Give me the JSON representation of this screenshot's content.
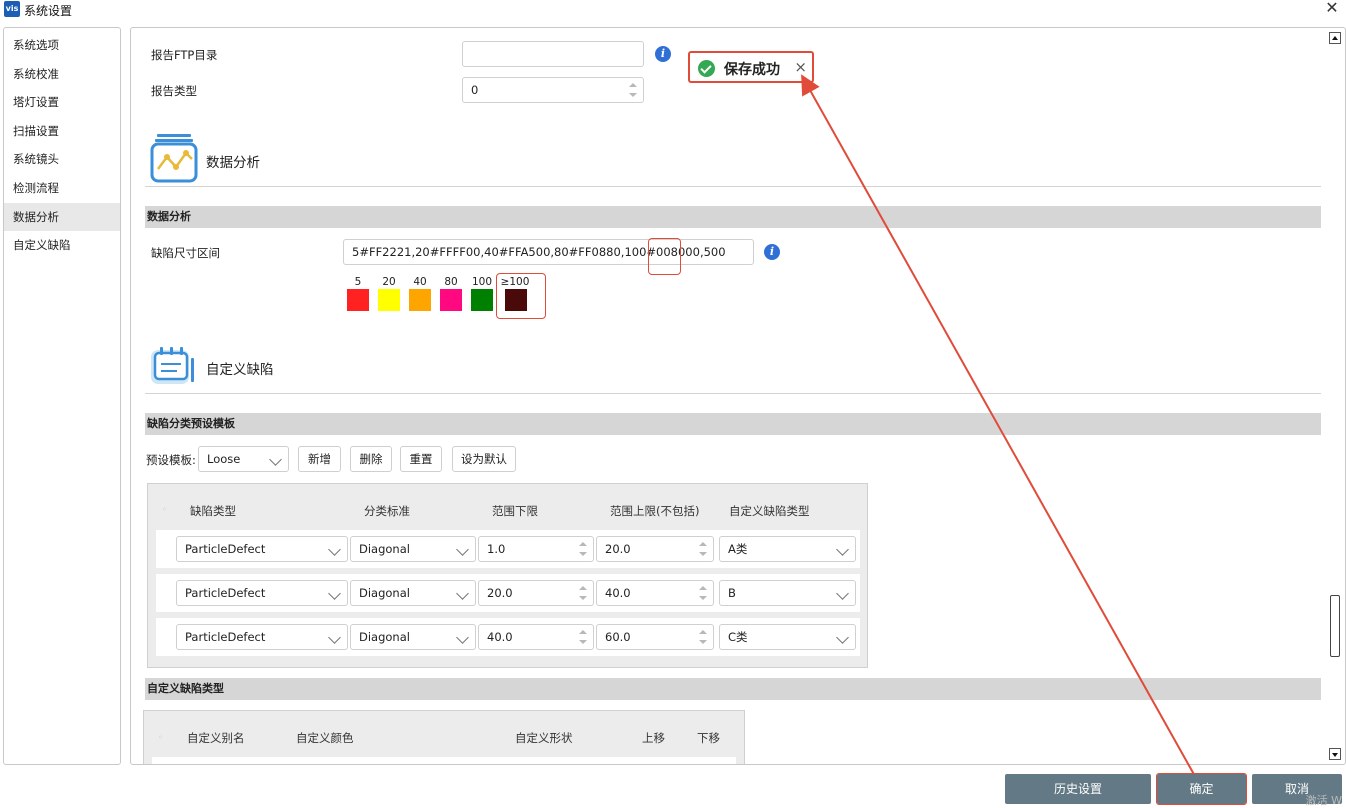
{
  "window": {
    "app_logo": "vis",
    "title": "系统设置",
    "close_glyph": "✕"
  },
  "sidebar": {
    "items": [
      {
        "label": "系统选项"
      },
      {
        "label": "系统校准"
      },
      {
        "label": "塔灯设置"
      },
      {
        "label": "扫描设置"
      },
      {
        "label": "系统镜头"
      },
      {
        "label": "检测流程"
      },
      {
        "label": "数据分析"
      },
      {
        "label": "自定义缺陷"
      }
    ],
    "active": "数据分析"
  },
  "report": {
    "ftp_label": "报告FTP目录",
    "ftp_value": "",
    "type_label": "报告类型",
    "type_value": "0"
  },
  "data_analysis": {
    "big_title": "数据分析",
    "section_header": "数据分析",
    "range_label": "缺陷尺寸区间",
    "range_value": "5#FF2221,20#FFFF00,40#FFA500,80#FF0880,100#008000,500",
    "swatches": [
      {
        "label": "5",
        "color": "#FF2221"
      },
      {
        "label": "20",
        "color": "#FFFF00"
      },
      {
        "label": "40",
        "color": "#FFA500"
      },
      {
        "label": "80",
        "color": "#FF0880"
      },
      {
        "label": "100",
        "color": "#008000"
      },
      {
        "label": "≥100",
        "color": "#4A0A0A"
      }
    ]
  },
  "custom_defect": {
    "big_title": "自定义缺陷",
    "template_section": "缺陷分类预设模板",
    "preset_label": "预设模板:",
    "preset_value": "Loose",
    "buttons": {
      "add": "新增",
      "delete": "删除",
      "reset": "重置",
      "set_default": "设为默认"
    },
    "columns": [
      "缺陷类型",
      "分类标准",
      "范围下限",
      "范围上限(不包括)",
      "自定义缺陷类型"
    ],
    "rows": [
      {
        "type": "ParticleDefect",
        "standard": "Diagonal",
        "lower": "1.0",
        "upper": "20.0",
        "custom": "A类"
      },
      {
        "type": "ParticleDefect",
        "standard": "Diagonal",
        "lower": "20.0",
        "upper": "40.0",
        "custom": "B"
      },
      {
        "type": "ParticleDefect",
        "standard": "Diagonal",
        "lower": "40.0",
        "upper": "60.0",
        "custom": "C类"
      }
    ],
    "type_section": "自定义缺陷类型",
    "type_columns": [
      "自定义别名",
      "自定义颜色",
      "自定义形状",
      "上移",
      "下移"
    ]
  },
  "toast": {
    "message": "保存成功",
    "close_glyph": "×"
  },
  "footer": {
    "history": "历史设置",
    "confirm": "确定",
    "cancel": "取消",
    "watermark": "激活 W"
  },
  "colors": {
    "accent_red": "#e04b3a",
    "footer_button": "#637a86",
    "section_header": "#d6d6d6",
    "success": "#34a853",
    "info": "#2f6fd6"
  }
}
